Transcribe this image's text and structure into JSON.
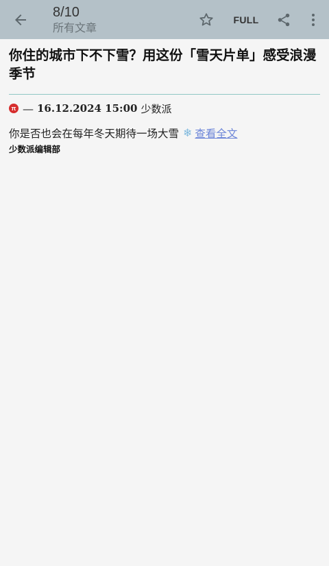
{
  "appbar": {
    "title": "8/10",
    "subtitle": "所有文章",
    "full_label": "FULL",
    "icons": {
      "back": "arrow-back-icon",
      "star": "star-outline-icon",
      "share": "share-icon",
      "more": "more-vert-icon"
    }
  },
  "article": {
    "title": "你住的城市下不下雪？用这份「雪天片单」感受浪漫季节",
    "meta": {
      "feed_icon_glyph": "π",
      "dash": "—",
      "datetime": "16.12.2024 15:00",
      "source": "少数派"
    },
    "summary": "你是否也会在每年冬天期待一场大雪",
    "summary_icon": "snowflake-icon",
    "read_more": "查看全文",
    "author": "少数派编辑部"
  },
  "colors": {
    "appbar_bg": "#b4c1c8",
    "content_bg": "#f5f5f5",
    "divider": "#8fc7c4",
    "link": "#6d86d8",
    "feed_icon": "#d62d2d"
  }
}
